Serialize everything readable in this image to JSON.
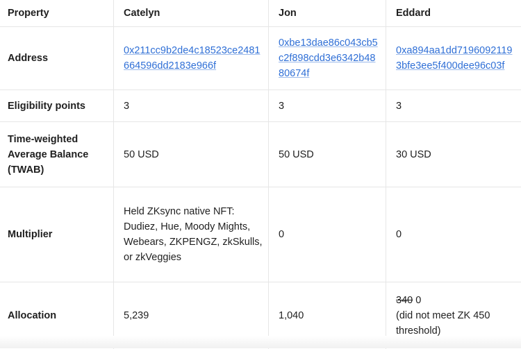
{
  "table": {
    "headers": [
      "Property",
      "Catelyn",
      "Jon",
      "Eddard"
    ],
    "rows": {
      "address": {
        "label": "Address",
        "catelyn": "0x211cc9b2de4c18523ce2481664596dd2183e966f",
        "jon": "0xbe13dae86c043cb5c2f898cdd3e6342b4880674f",
        "eddard": "0xa894aa1dd71960921193bfe3ee5f400dee96c03f"
      },
      "eligibility": {
        "label": "Eligibility points",
        "catelyn": "3",
        "jon": "3",
        "eddard": "3"
      },
      "twab": {
        "label": "Time-weighted Average Balance (TWAB)",
        "catelyn": "50 USD",
        "jon": "50 USD",
        "eddard": "30 USD"
      },
      "multiplier": {
        "label": "Multiplier",
        "catelyn": "Held ZKsync native NFT: Dudiez, Hue, Moody Mights, Webears, ZKPENGZ, zkSkulls, or zkVeggies",
        "jon": "0",
        "eddard": "0"
      },
      "allocation": {
        "label": "Allocation",
        "catelyn": "5,239",
        "jon": "1,040",
        "eddard_struck": "340",
        "eddard_value": "0",
        "eddard_note": "(did not meet ZK 450 threshold)"
      }
    }
  }
}
